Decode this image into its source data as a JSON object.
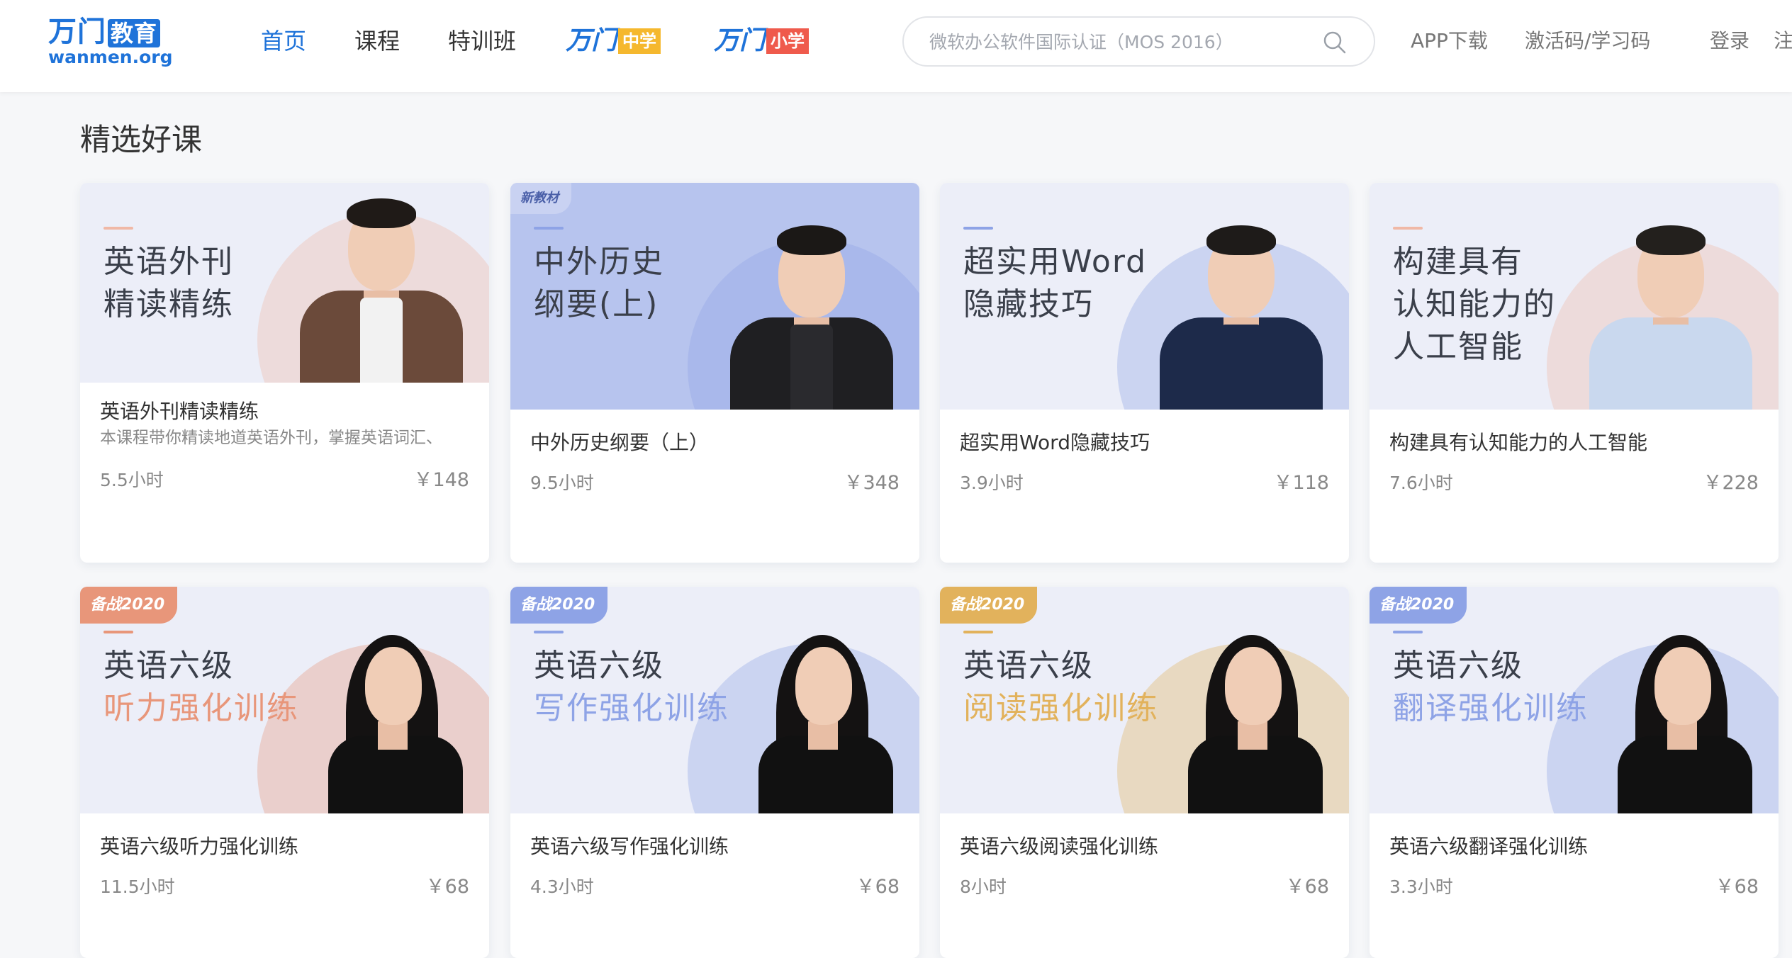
{
  "header": {
    "logo_cn": "万门",
    "logo_edu": "教育",
    "logo_en": "wanmen.org",
    "nav": [
      {
        "label": "首页",
        "active": true
      },
      {
        "label": "课程",
        "active": false
      },
      {
        "label": "特训班",
        "active": false
      }
    ],
    "sub_brands": [
      {
        "wordmark": "万门",
        "tag": "中学",
        "tag_color": "#f5b82e"
      },
      {
        "wordmark": "万门",
        "tag": "小学",
        "tag_color": "#ef5a4c"
      }
    ],
    "search_placeholder": "微软办公软件国际认证（MOS 2016）",
    "links": {
      "app": "APP下载",
      "code": "激活码/学习码",
      "login": "登录",
      "register": "注"
    }
  },
  "section": {
    "title": "精选好课"
  },
  "courses": [
    {
      "thumb_lines": [
        "英语外刊",
        "精读精练"
      ],
      "name": "英语外刊精读精练",
      "desc": "本课程带你精读地道英语外刊，掌握英语词汇、",
      "hours": "5.5小时",
      "price": "￥148",
      "badge": "",
      "thumb_bg": "#eceef8",
      "accent": "#f0b8a6"
    },
    {
      "thumb_lines": [
        "中外历史",
        "纲要(上)"
      ],
      "name": "中外历史纲要（上）",
      "desc": "",
      "hours": "9.5小时",
      "price": "￥348",
      "badge": "新教材",
      "thumb_bg": "#b7c4ee",
      "accent": "#8ea3e6"
    },
    {
      "thumb_lines": [
        "超实用Word",
        "隐藏技巧"
      ],
      "name": "超实用Word隐藏技巧",
      "desc": "",
      "hours": "3.9小时",
      "price": "￥118",
      "badge": "",
      "thumb_bg": "#eceef8",
      "accent": "#8ea3e6"
    },
    {
      "thumb_lines": [
        "构建具有",
        "认知能力的",
        "人工智能"
      ],
      "name": "构建具有认知能力的人工智能",
      "desc": "",
      "hours": "7.6小时",
      "price": "￥228",
      "badge": "",
      "thumb_bg": "#eceef8",
      "accent": "#f0b8a6"
    },
    {
      "thumb_lines": [
        "英语六级",
        "听力强化训练"
      ],
      "name": "英语六级听力强化训练",
      "desc": "",
      "hours": "11.5小时",
      "price": "￥68",
      "badge": "备战2020",
      "thumb_bg": "#eceef8",
      "accent": "#e8967a"
    },
    {
      "thumb_lines": [
        "英语六级",
        "写作强化训练"
      ],
      "name": "英语六级写作强化训练",
      "desc": "",
      "hours": "4.3小时",
      "price": "￥68",
      "badge": "备战2020",
      "thumb_bg": "#eceef8",
      "accent": "#8ea3e6"
    },
    {
      "thumb_lines": [
        "英语六级",
        "阅读强化训练"
      ],
      "name": "英语六级阅读强化训练",
      "desc": "",
      "hours": "8小时",
      "price": "￥68",
      "badge": "备战2020",
      "thumb_bg": "#eceef8",
      "accent": "#e2b25c"
    },
    {
      "thumb_lines": [
        "英语六级",
        "翻译强化训练"
      ],
      "name": "英语六级翻译强化训练",
      "desc": "",
      "hours": "3.3小时",
      "price": "￥68",
      "badge": "备战2020",
      "thumb_bg": "#eceef8",
      "accent": "#8ea3e6"
    }
  ]
}
